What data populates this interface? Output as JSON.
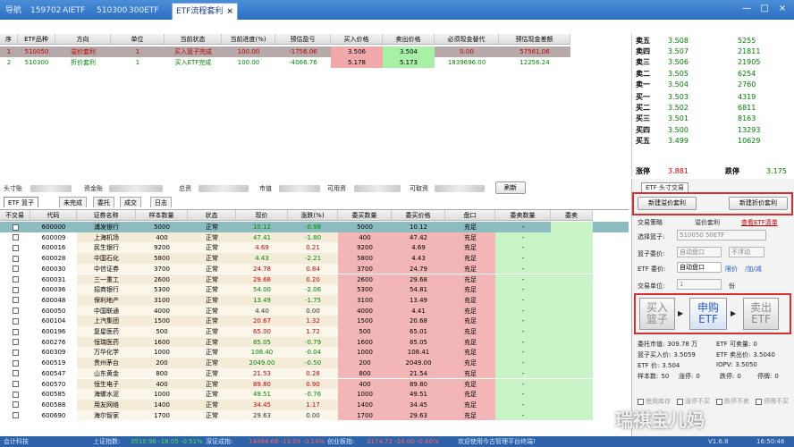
{
  "tabs": [
    {
      "label": "导航"
    },
    {
      "label": "159702"
    },
    {
      "label": "AIETF"
    },
    {
      "label": "510300"
    },
    {
      "label": "300ETF"
    },
    {
      "label": "ETF流程套利",
      "active": true,
      "close": "×"
    }
  ],
  "window_controls": [
    "—",
    "□",
    "×"
  ],
  "top_table": {
    "columns": [
      "序",
      "ETF品种",
      "方向",
      "单位",
      "当前状态",
      "当前进度(%)",
      "预估盈亏",
      "买入价格",
      "卖出价格",
      "必须现金替代",
      "预估现金差额"
    ],
    "rows": [
      {
        "seq": "1",
        "etf": "510050",
        "dir": "溢价套利",
        "unit": "1",
        "status": "买入篮子完成",
        "progress": "100.00",
        "pnl": "-1756.06",
        "buy": "3.506",
        "sell": "3.504",
        "cash": "0.00",
        "diff": "57561.06"
      },
      {
        "seq": "2",
        "etf": "510300",
        "dir": "折价套利",
        "unit": "1",
        "status": "买入ETF完成",
        "progress": "100.00",
        "pnl": "-4066.76",
        "buy": "5.178",
        "sell": "5.173",
        "cash": "1839696.00",
        "diff": "12256.24"
      }
    ]
  },
  "order_book": {
    "asks": [
      {
        "label": "卖五",
        "price": "3.508",
        "vol": "5255"
      },
      {
        "label": "卖四",
        "price": "3.507",
        "vol": "21811"
      },
      {
        "label": "卖三",
        "price": "3.506",
        "vol": "21905"
      },
      {
        "label": "卖二",
        "price": "3.505",
        "vol": "6254"
      },
      {
        "label": "卖一",
        "price": "3.504",
        "vol": "2760"
      }
    ],
    "bids": [
      {
        "label": "买一",
        "price": "3.503",
        "vol": "4319"
      },
      {
        "label": "买二",
        "price": "3.502",
        "vol": "6811"
      },
      {
        "label": "买三",
        "price": "3.501",
        "vol": "8163"
      },
      {
        "label": "买四",
        "price": "3.500",
        "vol": "13293"
      },
      {
        "label": "买五",
        "price": "3.499",
        "vol": "10629"
      }
    ],
    "limit_up_label": "涨停",
    "limit_up": "3.881",
    "limit_down_label": "跌停",
    "limit_down": "3.175"
  },
  "account": {
    "position_label": "头寸账",
    "fund_label": "资金账",
    "total_label": "总资",
    "mv_label": "市值",
    "avail_label": "可用资",
    "withdraw_label": "可取资",
    "refresh": "刷新"
  },
  "subtabs": [
    "ETF 篮子",
    "未完成",
    "委托",
    "成交",
    "日志"
  ],
  "basket": {
    "columns": [
      "不交易",
      "代码",
      "证券名称",
      "样本数量",
      "状态",
      "现价",
      "涨跌(%)",
      "委买数量",
      "委买价格",
      "盘口",
      "委卖数量",
      "委卖"
    ],
    "rows": [
      {
        "code": "600000",
        "name": "浦发银行",
        "qty": "5000",
        "status": "正常",
        "price": "10.12",
        "chg": "-0.98",
        "bq": "5000",
        "bp": "10.12",
        "pk": "充足",
        "sq": "-"
      },
      {
        "code": "600009",
        "name": "上海机场",
        "qty": "400",
        "status": "正常",
        "price": "47.41",
        "chg": "-1.80",
        "bq": "400",
        "bp": "47.42",
        "pk": "充足",
        "sq": "-"
      },
      {
        "code": "600016",
        "name": "民生银行",
        "qty": "9200",
        "status": "正常",
        "price": "4.69",
        "chg": "0.21",
        "bq": "9200",
        "bp": "4.69",
        "pk": "充足",
        "sq": "-"
      },
      {
        "code": "600028",
        "name": "中国石化",
        "qty": "5800",
        "status": "正常",
        "price": "4.43",
        "chg": "-2.21",
        "bq": "5800",
        "bp": "4.43",
        "pk": "充足",
        "sq": "-"
      },
      {
        "code": "600030",
        "name": "中信证券",
        "qty": "3700",
        "status": "正常",
        "price": "24.78",
        "chg": "0.84",
        "bq": "3700",
        "bp": "24.79",
        "pk": "充足",
        "sq": "-"
      },
      {
        "code": "600031",
        "name": "三一重工",
        "qty": "2600",
        "status": "正常",
        "price": "29.68",
        "chg": "0.20",
        "bq": "2600",
        "bp": "29.68",
        "pk": "充足",
        "sq": "-"
      },
      {
        "code": "600036",
        "name": "招商银行",
        "qty": "5300",
        "status": "正常",
        "price": "54.00",
        "chg": "-2.06",
        "bq": "5300",
        "bp": "54.81",
        "pk": "充足",
        "sq": "-"
      },
      {
        "code": "600048",
        "name": "保利地产",
        "qty": "3100",
        "status": "正常",
        "price": "13.49",
        "chg": "-1.75",
        "bq": "3100",
        "bp": "13.49",
        "pk": "充足",
        "sq": "-"
      },
      {
        "code": "600050",
        "name": "中国联通",
        "qty": "4000",
        "status": "正常",
        "price": "4.40",
        "chg": "0.00",
        "bq": "4000",
        "bp": "4.41",
        "pk": "充足",
        "sq": "-"
      },
      {
        "code": "600104",
        "name": "上汽集团",
        "qty": "1500",
        "status": "正常",
        "price": "20.67",
        "chg": "1.32",
        "bq": "1500",
        "bp": "20.68",
        "pk": "充足",
        "sq": "-"
      },
      {
        "code": "600196",
        "name": "复星医药",
        "qty": "500",
        "status": "正常",
        "price": "65.00",
        "chg": "1.72",
        "bq": "500",
        "bp": "65.01",
        "pk": "充足",
        "sq": "-"
      },
      {
        "code": "600276",
        "name": "恒瑞医药",
        "qty": "1600",
        "status": "正常",
        "price": "85.05",
        "chg": "-0.79",
        "bq": "1600",
        "bp": "85.05",
        "pk": "充足",
        "sq": "-"
      },
      {
        "code": "600309",
        "name": "万华化学",
        "qty": "1000",
        "status": "正常",
        "price": "108.40",
        "chg": "-0.04",
        "bq": "1000",
        "bp": "108.41",
        "pk": "充足",
        "sq": "-"
      },
      {
        "code": "600519",
        "name": "贵州茅台",
        "qty": "200",
        "status": "正常",
        "price": "2049.00",
        "chg": "-0.50",
        "bq": "200",
        "bp": "2049.00",
        "pk": "充足",
        "sq": "-"
      },
      {
        "code": "600547",
        "name": "山东黄金",
        "qty": "800",
        "status": "正常",
        "price": "21.53",
        "chg": "0.28",
        "bq": "800",
        "bp": "21.54",
        "pk": "充足",
        "sq": "-"
      },
      {
        "code": "600570",
        "name": "恒生电子",
        "qty": "400",
        "status": "正常",
        "price": "89.80",
        "chg": "0.90",
        "bq": "400",
        "bp": "89.80",
        "pk": "充足",
        "sq": "-"
      },
      {
        "code": "600585",
        "name": "海螺水泥",
        "qty": "1000",
        "status": "正常",
        "price": "49.51",
        "chg": "-0.76",
        "bq": "1000",
        "bp": "49.51",
        "pk": "充足",
        "sq": "-"
      },
      {
        "code": "600588",
        "name": "用友网络",
        "qty": "1400",
        "status": "正常",
        "price": "34.45",
        "chg": "1.17",
        "bq": "1400",
        "bp": "34.45",
        "pk": "充足",
        "sq": "-"
      },
      {
        "code": "600690",
        "name": "海尔智家",
        "qty": "1700",
        "status": "正常",
        "price": "29.63",
        "chg": "0.00",
        "bq": "1700",
        "bp": "29.63",
        "pk": "充足",
        "sq": "-"
      }
    ]
  },
  "right_panel": {
    "tab": "ETF 头寸交易",
    "new_premium": "新建溢价套利",
    "new_discount": "新建折价套利",
    "strategy_label": "交易策略",
    "strategy_value": "溢价套利",
    "view_list": "查看ETF清单",
    "basket_label": "选择篮子:",
    "basket_value": "510050 50ETF",
    "basket_price_label": "篮子委价:",
    "basket_price_value": "自动盘口",
    "floating": "不浮动",
    "etf_price_label": "ETF 委价:",
    "etf_price_value": "自动盘口",
    "limit": "限价",
    "add_sub": "/加/减",
    "unit_label": "交易单位:",
    "unit_value": "1",
    "unit_suffix": "份",
    "buy_basket": [
      "买入",
      "篮子"
    ],
    "subscribe": [
      "申购",
      "ETF"
    ],
    "sell_etf": [
      "卖出",
      "ETF"
    ],
    "stats": [
      {
        "l": "委托市值:",
        "v": "309.78 万"
      },
      {
        "l": "ETF 可卖量:",
        "v": "0"
      },
      {
        "l": "篮子买入价:",
        "v": "3.5059"
      },
      {
        "l": "ETF 卖出价:",
        "v": "3.5040"
      },
      {
        "l": "ETF 价:",
        "v": "3.504"
      },
      {
        "l": "IOPV:",
        "v": "3.5050"
      },
      {
        "l": "样本数:",
        "v": "50"
      },
      {
        "l": "涨停:",
        "v": "0"
      },
      {
        "l": "跌停:",
        "v": "0"
      },
      {
        "l": "停牌:",
        "v": "0"
      }
    ],
    "checks": [
      "使用库存",
      "涨停不买",
      "跌停不卖",
      "停牌不买"
    ]
  },
  "status_bar": {
    "left": "会计科技",
    "sh_label": "上证指数:",
    "sh": "3510.96 -18.05 -0.51%",
    "sz_label": "深证成指:",
    "sz": "14484.68 -13.09 -0.14%",
    "cy_label": "创业板指:",
    "cy": "3174.72 -24.00 -0.60%",
    "welcome": "欢迎使用今古管理平台终端!",
    "version": "V1.6.8",
    "time": "16:50:46"
  },
  "watermark": "瑞祺宝儿妈"
}
